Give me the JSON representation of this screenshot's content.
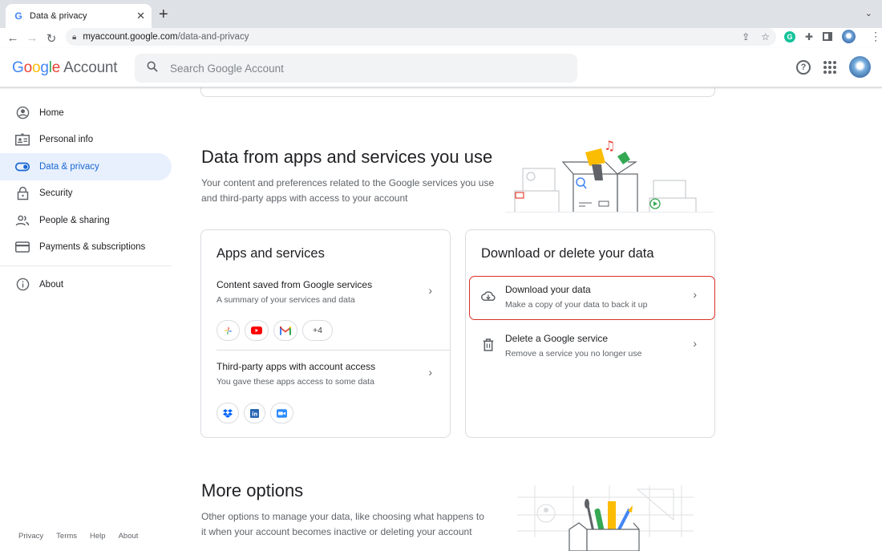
{
  "browser": {
    "tab_title": "Data & privacy",
    "tab_favicon": "G",
    "url_host": "myaccount.google.com",
    "url_path": "/data-and-privacy"
  },
  "header": {
    "logo_letters": [
      "G",
      "o",
      "o",
      "g",
      "l",
      "e"
    ],
    "logo_suffix": "Account",
    "search_placeholder": "Search Google Account"
  },
  "sidebar": {
    "items": [
      {
        "label": "Home",
        "icon": "account-circle-icon"
      },
      {
        "label": "Personal info",
        "icon": "id-card-icon"
      },
      {
        "label": "Data & privacy",
        "icon": "toggle-icon",
        "active": true
      },
      {
        "label": "Security",
        "icon": "lock-icon"
      },
      {
        "label": "People & sharing",
        "icon": "people-icon"
      },
      {
        "label": "Payments & subscriptions",
        "icon": "credit-card-icon"
      }
    ],
    "about": {
      "label": "About",
      "icon": "info-icon"
    }
  },
  "footer": {
    "links": [
      "Privacy",
      "Terms",
      "Help",
      "About"
    ]
  },
  "section_apps": {
    "title": "Data from apps and services you use",
    "description": "Your content and preferences related to the Google services you use and third-party apps with access to your account"
  },
  "apps_card": {
    "title": "Apps and services",
    "rows": [
      {
        "title": "Content saved from Google services",
        "description": "A summary of your services and data",
        "chips": [
          "google-photos-icon",
          "youtube-icon",
          "gmail-icon"
        ],
        "more_label": "+4"
      },
      {
        "title": "Third-party apps with account access",
        "description": "You gave these apps access to some data",
        "chips": [
          "dropbox-icon",
          "linkedin-icon",
          "zoom-icon"
        ]
      }
    ]
  },
  "download_card": {
    "title": "Download or delete your data",
    "rows": [
      {
        "title": "Download your data",
        "description": "Make a copy of your data to back it up",
        "icon": "cloud-download-icon",
        "highlighted": true
      },
      {
        "title": "Delete a Google service",
        "description": "Remove a service you no longer use",
        "icon": "trash-icon"
      }
    ]
  },
  "section_more": {
    "title": "More options",
    "description": "Other options to manage your data, like choosing what happens to it when your account becomes inactive or deleting your account"
  },
  "colors": {
    "accent": "#1967d2",
    "active_bg": "#e8f0fe",
    "highlight_border": "#d93025"
  }
}
